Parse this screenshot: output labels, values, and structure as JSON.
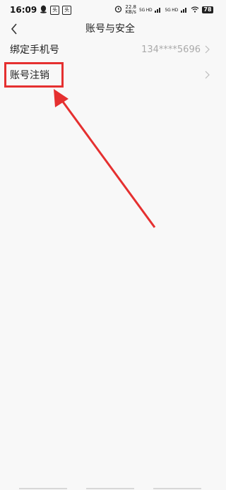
{
  "status_bar": {
    "time": "16:09",
    "notification_icons": [
      "qq-icon",
      "app-icon",
      "app-icon"
    ],
    "app_icon_text": "头",
    "net_speed_value": "22.8",
    "net_speed_unit": "KB/s",
    "network_1": "5G HD",
    "network_2": "5G HD",
    "battery": "78"
  },
  "nav": {
    "title": "账号与安全"
  },
  "rows": [
    {
      "label": "绑定手机号",
      "value": "134****5696"
    },
    {
      "label": "账号注销",
      "value": ""
    }
  ],
  "annotation": {
    "color": "#e53030"
  }
}
